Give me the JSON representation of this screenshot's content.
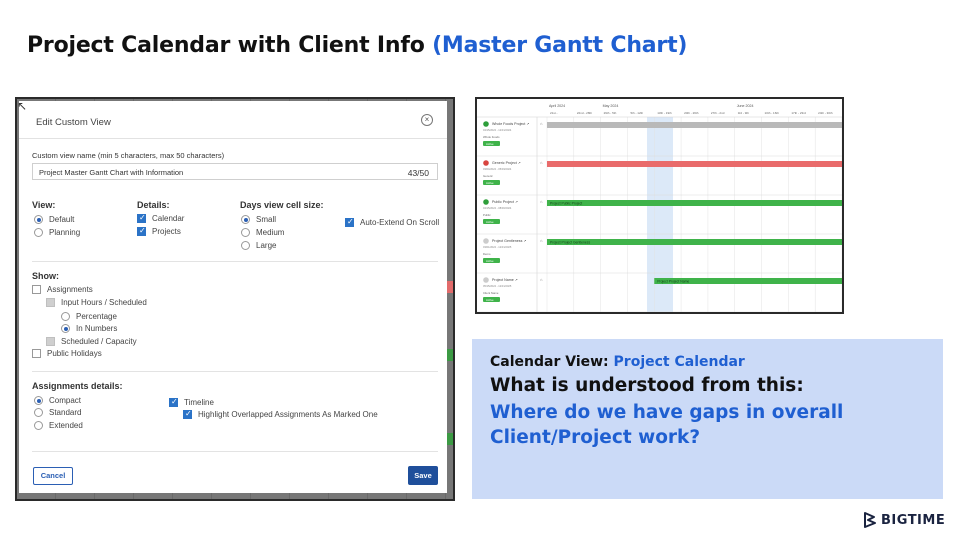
{
  "slide": {
    "title_main": "Project Calendar with Client Info",
    "title_accent": "(Master Gantt Chart)"
  },
  "dialog": {
    "title": "Edit Custom View",
    "name_label": "Custom view name (min 5 characters, max 50 characters)",
    "name_value": "Project Master Gantt Chart with Information",
    "name_count": "43/50",
    "view": {
      "heading": "View:",
      "options": [
        "Default",
        "Planning"
      ],
      "selected": "Default"
    },
    "details": {
      "heading": "Details:",
      "options": [
        "Calendar",
        "Projects"
      ]
    },
    "days": {
      "heading": "Days view cell size:",
      "options": [
        "Small",
        "Medium",
        "Large"
      ],
      "selected": "Small"
    },
    "auto_extend": "Auto-Extend On Scroll",
    "show": {
      "heading": "Show:",
      "assignments": "Assignments",
      "input_hours": "Input Hours / Scheduled",
      "percentage": "Percentage",
      "in_numbers": "In Numbers",
      "scheduled_capacity": "Scheduled / Capacity",
      "public_holidays": "Public Holidays"
    },
    "assign_details": {
      "heading": "Assignments details:",
      "options": [
        "Compact",
        "Standard",
        "Extended"
      ],
      "selected": "Compact",
      "timeline": "Timeline",
      "highlight": "Highlight Overlapped Assignments As Marked One"
    },
    "cancel_label": "Cancel",
    "save_label": "Save"
  },
  "gantt": {
    "months": [
      "April 2024",
      "May 2024",
      "June 2024"
    ],
    "weeks": [
      "21st - ",
      "22nd - 28th",
      "29th - 5th",
      "5th - 12th",
      "13th - 19th",
      "20th - 26th",
      "27th - 2nd",
      "3rd - 9th",
      "10th - 16th",
      "17th - 23rd",
      "24th - 30th"
    ],
    "rows": [
      {
        "project": "Whole Foods Project",
        "dates": "04/15/2024 - 12/31/2024",
        "client": "Whole Foods",
        "badge": "Active",
        "bar_color": "#b9b9b9",
        "bar_label": "",
        "status_color": "#2e9e3a"
      },
      {
        "project": "Generic Project",
        "dates": "03/04/2024 - 05/03/2024",
        "client": "Generic",
        "badge": "Active",
        "bar_color": "#e96b6b",
        "bar_label": "",
        "status_color": "#d8453f"
      },
      {
        "project": "Public Project",
        "dates": "04/15/2024 - 08/30/2024",
        "client": "Public",
        "badge": "Active",
        "bar_color": "#3fb34a",
        "bar_label": "Project Public Project",
        "status_color": "#2e9e3a"
      },
      {
        "project": "Project Gentleness",
        "dates": "03/01/2024 - 12/31/2025",
        "client": "Demo",
        "badge": "Active",
        "bar_color": "#3fb34a",
        "bar_label": "Project Project Gentleness",
        "status_color": "#cccccc"
      },
      {
        "project": "Project Name",
        "dates": "05/15/2024 - 12/31/2025",
        "client": "Client Name",
        "badge": "Active",
        "bar_color": "#3fb34a",
        "bar_label": "Project Project Name",
        "status_color": "#cccccc"
      }
    ]
  },
  "info": {
    "view_label": "Calendar View:",
    "view_value": "Project Calendar",
    "question": "What is understood from this:",
    "answer": "Where do we have gaps in overall Client/Project work?"
  },
  "logo": {
    "text": "BIGTIME"
  },
  "colors": {
    "accent": "#1f5fd1",
    "info_bg": "#cbdaf7",
    "save_btn": "#1f4f9b"
  }
}
